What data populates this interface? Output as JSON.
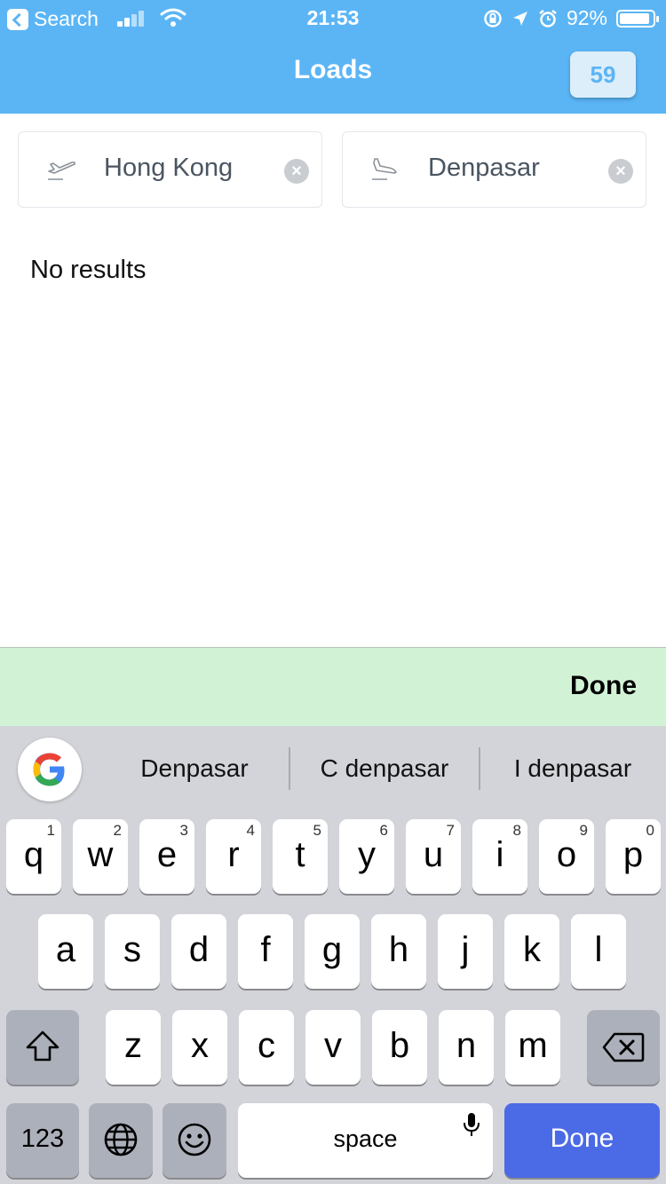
{
  "status_bar": {
    "back_label": "Search",
    "time": "21:53",
    "battery": "92%",
    "battery_level": 0.92
  },
  "nav": {
    "title": "Loads",
    "badge_count": "59"
  },
  "route": {
    "origin": "Hong Kong",
    "destination": "Denpasar"
  },
  "results": {
    "empty_text": "No results"
  },
  "toolbar": {
    "done_label": "Done"
  },
  "keyboard": {
    "suggestions": [
      "Denpasar",
      "C denpasar",
      "I denpasar"
    ],
    "row1": [
      {
        "letter": "q",
        "num": "1"
      },
      {
        "letter": "w",
        "num": "2"
      },
      {
        "letter": "e",
        "num": "3"
      },
      {
        "letter": "r",
        "num": "4"
      },
      {
        "letter": "t",
        "num": "5"
      },
      {
        "letter": "y",
        "num": "6"
      },
      {
        "letter": "u",
        "num": "7"
      },
      {
        "letter": "i",
        "num": "8"
      },
      {
        "letter": "o",
        "num": "9"
      },
      {
        "letter": "p",
        "num": "0"
      }
    ],
    "row2": [
      "a",
      "s",
      "d",
      "f",
      "g",
      "h",
      "j",
      "k",
      "l"
    ],
    "row3": [
      "z",
      "x",
      "c",
      "v",
      "b",
      "n",
      "m"
    ],
    "numbers_label": "123",
    "space_label": "space",
    "done_label": "Done",
    "icons": [
      "shift-icon",
      "backspace-icon",
      "globe-icon",
      "emoji-icon",
      "microphone-icon",
      "google-icon"
    ]
  },
  "colors": {
    "nav_blue": "#5bb5f5",
    "done_bar": "#d2f2d6",
    "keyboard_bg": "#d2d4d9",
    "done_key": "#4b6ae6"
  }
}
